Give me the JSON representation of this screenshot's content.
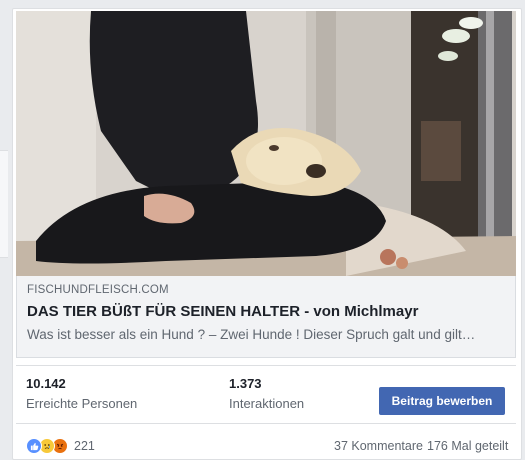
{
  "link": {
    "domain": "FISCHUNDFLEISCH.COM",
    "title": "DAS TIER BÜßT FÜR SEINEN HALTER - von Michlmayr",
    "description": "Was ist besser als ein Hund ? – Zwei Hunde ! Dieser Spruch galt und gilt…"
  },
  "stats": {
    "reach_value": "10.142",
    "reach_label": "Erreichte Personen",
    "interactions_value": "1.373",
    "interactions_label": "Interaktionen",
    "boost_label": "Beitrag bewerben"
  },
  "footer": {
    "reactions": [
      "like-icon",
      "sad-icon",
      "angry-icon"
    ],
    "reaction_count": "221",
    "comments": "37 Kommentare",
    "shares": "176 Mal geteilt"
  },
  "colors": {
    "boost_button": "#4267b2",
    "like": "#5890ff",
    "sad": "#f7c93a",
    "angry": "#e9710f"
  }
}
